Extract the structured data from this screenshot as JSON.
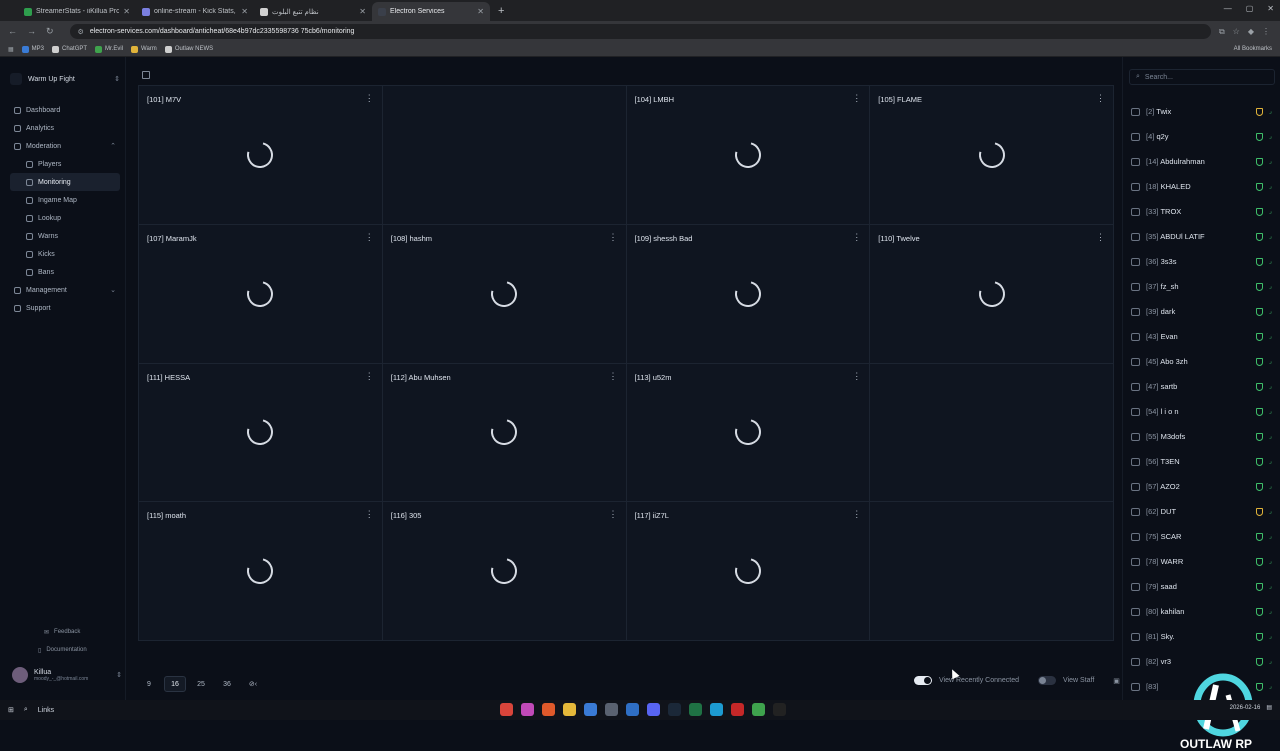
{
  "browser": {
    "tabs": [
      {
        "title": "StreamerStats - iiKillua Profile",
        "color": "#2e9e4d",
        "active": false
      },
      {
        "title": "online-stream - Kick Stats, Anal",
        "color": "#7a7fe0",
        "active": false
      },
      {
        "title": "نظام تتبع البلوت",
        "color": "#d0d0d0",
        "active": false
      },
      {
        "title": "Electron Services",
        "color": "#3a3f4a",
        "active": true
      }
    ],
    "url": "electron-services.com/dashboard/anticheat/68e4b97dc2335598736 75cb6/monitoring",
    "bookmarks": [
      {
        "label": "MP3",
        "color": "#3a7bd5"
      },
      {
        "label": "ChatGPT",
        "color": "#cfcfcf"
      },
      {
        "label": "Mr.Evil",
        "color": "#3fa34d"
      },
      {
        "label": "Warm",
        "color": "#e0b33a"
      },
      {
        "label": "Outlaw NEWS",
        "color": "#cfcfcf"
      }
    ],
    "all_bookmarks": "All Bookmarks"
  },
  "sidebar": {
    "team": "Warm Up Fight",
    "items": [
      {
        "label": "Dashboard",
        "sub": false,
        "active": false,
        "chev": ""
      },
      {
        "label": "Analytics",
        "sub": false,
        "active": false,
        "chev": ""
      },
      {
        "label": "Moderation",
        "sub": false,
        "active": false,
        "chev": "⌃"
      },
      {
        "label": "Players",
        "sub": true,
        "active": false,
        "chev": ""
      },
      {
        "label": "Monitoring",
        "sub": true,
        "active": true,
        "chev": ""
      },
      {
        "label": "Ingame Map",
        "sub": true,
        "active": false,
        "chev": ""
      },
      {
        "label": "Lookup",
        "sub": true,
        "active": false,
        "chev": ""
      },
      {
        "label": "Warns",
        "sub": true,
        "active": false,
        "chev": ""
      },
      {
        "label": "Kicks",
        "sub": true,
        "active": false,
        "chev": ""
      },
      {
        "label": "Bans",
        "sub": true,
        "active": false,
        "chev": ""
      },
      {
        "label": "Management",
        "sub": false,
        "active": false,
        "chev": "⌄"
      },
      {
        "label": "Support",
        "sub": false,
        "active": false,
        "chev": ""
      }
    ],
    "feedback": "Feedback",
    "documentation": "Documentation",
    "user": {
      "name": "Killua",
      "email": "moody_-_@hotmail.com"
    }
  },
  "grid": {
    "cells": [
      {
        "label": "[101] M7V",
        "loading": true
      },
      {
        "label": "",
        "loading": false
      },
      {
        "label": "[104] LMBH",
        "loading": true
      },
      {
        "label": "[105] FLAME",
        "loading": true
      },
      {
        "label": "[107] MaramJk",
        "loading": true
      },
      {
        "label": "[108] hashm",
        "loading": true
      },
      {
        "label": "[109] shessh Bad",
        "loading": true
      },
      {
        "label": "[110] Twelve",
        "loading": true
      },
      {
        "label": "[111] HESSA",
        "loading": true
      },
      {
        "label": "[112] Abu Muhsen",
        "loading": true
      },
      {
        "label": "[113] u52m",
        "loading": true
      },
      {
        "label": "",
        "loading": false
      },
      {
        "label": "[115] moath",
        "loading": true
      },
      {
        "label": "[116] 305",
        "loading": true
      },
      {
        "label": "[117] iiZ7L",
        "loading": true
      },
      {
        "label": "",
        "loading": false
      }
    ]
  },
  "pager": {
    "sizes": [
      "9",
      "16",
      "25",
      "36"
    ],
    "selected": "16",
    "extra": "⊘‹"
  },
  "controls": {
    "recent": "View Recently Connected",
    "staff": "View Staff"
  },
  "players": {
    "search_placeholder": "Search...",
    "list": [
      {
        "id": "[2]",
        "name": "Twix",
        "yellow": true
      },
      {
        "id": "[4]",
        "name": "q2y",
        "yellow": false
      },
      {
        "id": "[14]",
        "name": "Abdulrahman",
        "yellow": false
      },
      {
        "id": "[18]",
        "name": "KHALED",
        "yellow": false
      },
      {
        "id": "[33]",
        "name": "TROX",
        "yellow": false
      },
      {
        "id": "[35]",
        "name": "ABDUl LATIF",
        "yellow": false
      },
      {
        "id": "[36]",
        "name": "3s3s",
        "yellow": false
      },
      {
        "id": "[37]",
        "name": "fz_sh",
        "yellow": false
      },
      {
        "id": "[39]",
        "name": "dark",
        "yellow": false
      },
      {
        "id": "[43]",
        "name": "Evan",
        "yellow": false
      },
      {
        "id": "[45]",
        "name": "Abo 3zh",
        "yellow": false
      },
      {
        "id": "[47]",
        "name": "sartb",
        "yellow": false
      },
      {
        "id": "[54]",
        "name": "l i o n",
        "yellow": false
      },
      {
        "id": "[55]",
        "name": "M3dofs",
        "yellow": false
      },
      {
        "id": "[56]",
        "name": "T3EN",
        "yellow": false
      },
      {
        "id": "[57]",
        "name": "AZO2",
        "yellow": false
      },
      {
        "id": "[62]",
        "name": "DUT",
        "yellow": true
      },
      {
        "id": "[75]",
        "name": "SCAR",
        "yellow": false
      },
      {
        "id": "[78]",
        "name": "WARR",
        "yellow": false
      },
      {
        "id": "[79]",
        "name": "saad",
        "yellow": false
      },
      {
        "id": "[80]",
        "name": "kahilan",
        "yellow": false
      },
      {
        "id": "[81]",
        "name": "Sky.",
        "yellow": false
      },
      {
        "id": "[82]",
        "name": "vr3",
        "yellow": false
      },
      {
        "id": "[83]",
        "name": "",
        "yellow": false
      }
    ]
  },
  "taskbar": {
    "search": "Links",
    "date": "2026-02-16"
  },
  "overlay_logo": "OUTLAW RP"
}
